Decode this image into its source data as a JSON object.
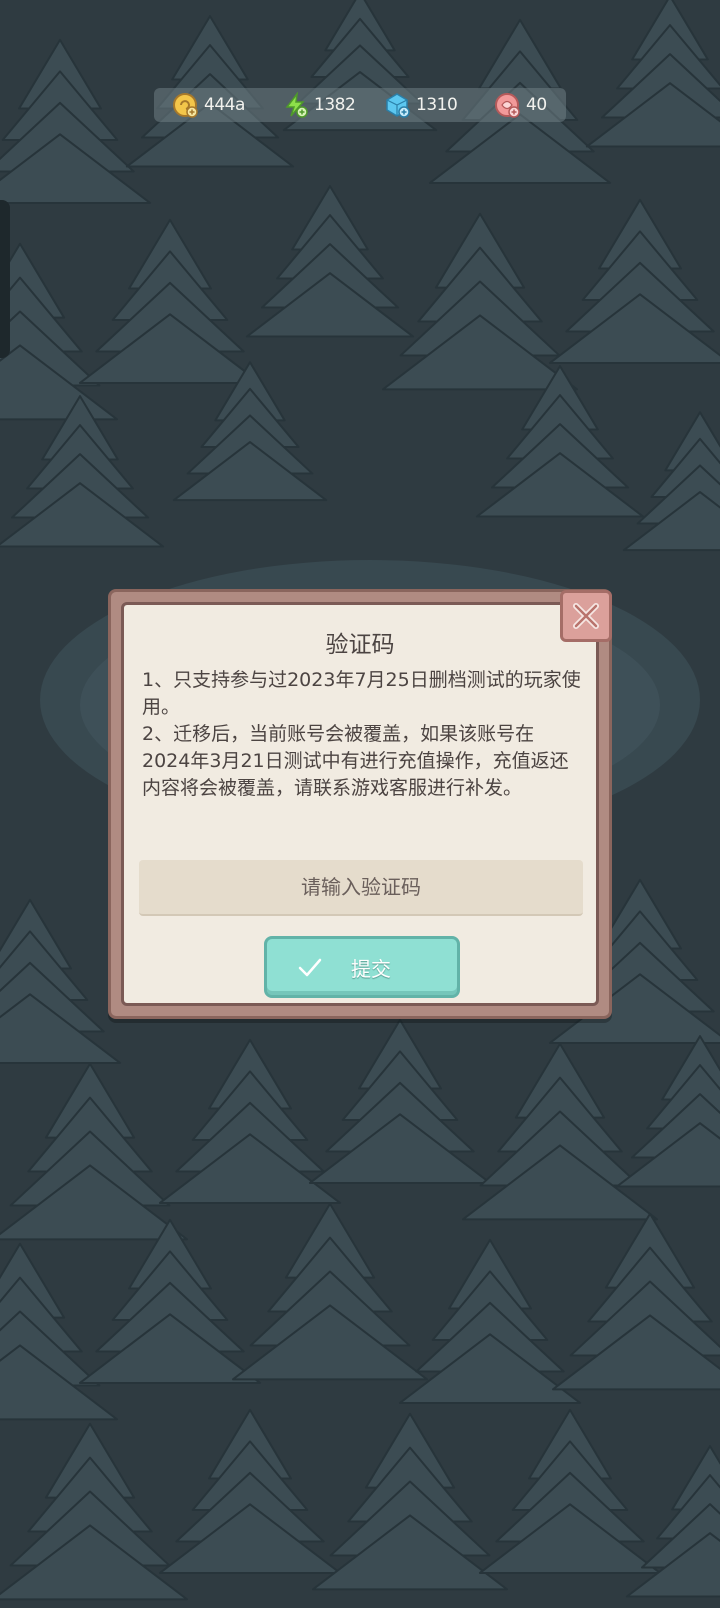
{
  "currencies": {
    "coins": {
      "icon": "gold-coin-icon",
      "value": "444a"
    },
    "energy": {
      "icon": "lightning-bolt-icon",
      "value": "1382"
    },
    "gems": {
      "icon": "blue-gem-icon",
      "value": "1310"
    },
    "tickets": {
      "icon": "pink-token-icon",
      "value": "40"
    }
  },
  "dialog": {
    "title": "验证码",
    "paragraph_1": "1、只支持参与过2023年7月25日删档测试的玩家使用。",
    "paragraph_2": "2、迁移后，当前账号会被覆盖，如果该账号在2024年3月21日测试中有进行充值操作，充值返还内容将会被覆盖，请联系游戏客服进行补发。",
    "input": {
      "value": "",
      "placeholder": "请输入验证码"
    },
    "submit_label": "提交",
    "close_icon": "close-icon"
  },
  "colors": {
    "background": "#2f3b41",
    "dialog_frame": "#b08b82",
    "dialog_panel": "#f1ebe1",
    "submit_button": "#8fe0d3",
    "close_button": "#dba09b"
  }
}
